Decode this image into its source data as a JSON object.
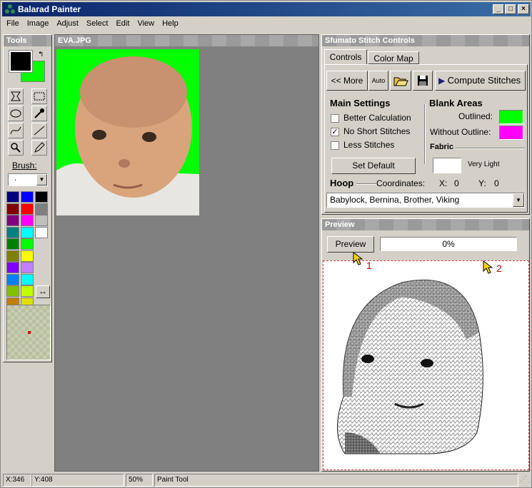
{
  "window": {
    "title": "Balarad Painter"
  },
  "menu": [
    "File",
    "Image",
    "Adjust",
    "Select",
    "Edit",
    "View",
    "Help"
  ],
  "tools_panel": {
    "title": "Tools",
    "brush_label": "Brush:",
    "brush_value": "."
  },
  "canvas": {
    "title": "EVA.JPG"
  },
  "stitch": {
    "title": "Sfumato Stitch Controls",
    "tabs": [
      "Controls",
      "Color Map"
    ],
    "more_label": "<< More",
    "auto_label": "Auto",
    "compute_label": "Compute Stitches",
    "main_settings": "Main Settings",
    "better_calc": "Better Calculation",
    "no_short": "No Short Stitches",
    "less_stitches": "Less Stitches",
    "set_default": "Set Default",
    "blank_areas": "Blank Areas",
    "outlined": "Outlined:",
    "without_outline": "Without Outline:",
    "fabric": "Fabric",
    "fabric_value": "Very Light",
    "hoop": "Hoop",
    "coordinates": "Coordinates:",
    "x_label": "X:",
    "x_value": "0",
    "y_label": "Y:",
    "y_value": "0",
    "machine": "Babylock, Bernina, Brother, Viking",
    "checks": {
      "better": false,
      "no_short": true,
      "less": false
    }
  },
  "preview": {
    "title": "Preview",
    "button": "Preview",
    "progress": "0%",
    "progress_fraction": 0,
    "marker1": "1",
    "marker2": "2"
  },
  "statusbar": {
    "x": "X:346",
    "y": "Y:408",
    "zoom": "50%",
    "tool": "Paint Tool"
  },
  "colors": {
    "titlebar": "#0a246a",
    "outlined": "#00ff00",
    "without_outline": "#ff00ff",
    "background_green": "#00ff00",
    "marker": "#cc0000"
  },
  "palette": [
    [
      "#000080",
      "#0000ff",
      "#000000"
    ],
    [
      "#800000",
      "#ff0000",
      "#808080"
    ],
    [
      "#800080",
      "#ff00ff",
      "#c0c0c0"
    ],
    [
      "#008080",
      "#00ffff",
      "#ffffff"
    ],
    [
      "#008000",
      "#00ff00",
      ""
    ],
    [
      "#808000",
      "#ffff00",
      ""
    ],
    [
      "#8000ff",
      "#c080ff",
      ""
    ],
    [
      "#0080ff",
      "#00ffff",
      ""
    ],
    [
      "#80c000",
      "#c0ff00",
      ""
    ],
    [
      "#c08000",
      "#e0e000",
      ""
    ]
  ]
}
